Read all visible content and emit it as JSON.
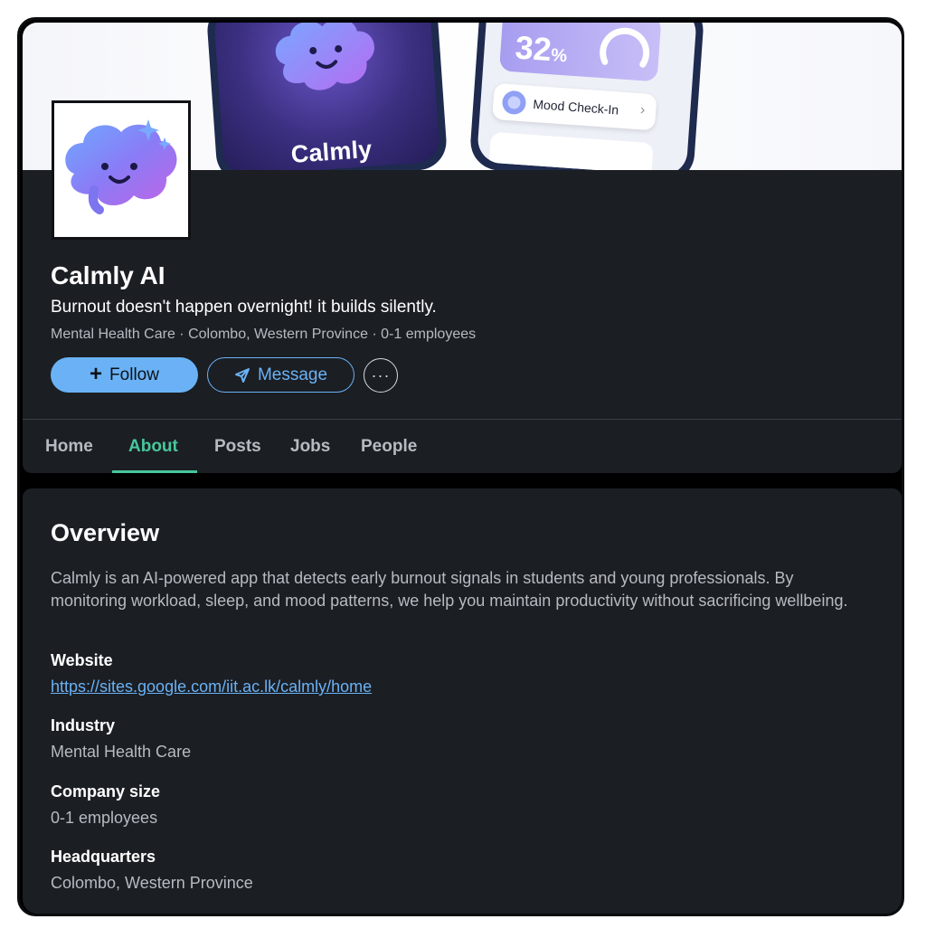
{
  "banner": {
    "left_phone_app_name": "Calmly",
    "right_phone_stat_value": "32",
    "right_phone_stat_unit": "%",
    "right_phone_mood_label": "Mood Check-In",
    "right_phone_mood_chevron": "›"
  },
  "company": {
    "name": "Calmly AI",
    "tagline": "Burnout doesn't happen overnight! it builds silently.",
    "meta": "Mental Health Care · Colombo, Western Province · 0-1 employees"
  },
  "actions": {
    "follow_label": "Follow",
    "follow_icon": "+",
    "message_label": "Message",
    "more_label": "···"
  },
  "tabs": [
    {
      "label": "Home",
      "active": false
    },
    {
      "label": "About",
      "active": true
    },
    {
      "label": "Posts",
      "active": false
    },
    {
      "label": "Jobs",
      "active": false
    },
    {
      "label": "People",
      "active": false
    }
  ],
  "overview": {
    "title": "Overview",
    "description": "Calmly is an AI-powered app that detects early burnout signals in students and young professionals. By monitoring workload, sleep, and mood patterns, we help you maintain productivity without sacrificing wellbeing.",
    "website_label": "Website",
    "website_url": "https://sites.google.com/iit.ac.lk/calmly/home",
    "industry_label": "Industry",
    "industry_value": "Mental Health Care",
    "size_label": "Company size",
    "size_value": "0-1 employees",
    "hq_label": "Headquarters",
    "hq_value": "Colombo, Western Province"
  },
  "colors": {
    "accent_blue": "#6ab2f5",
    "accent_green": "#48c79a",
    "card_bg": "#1b1e23"
  }
}
